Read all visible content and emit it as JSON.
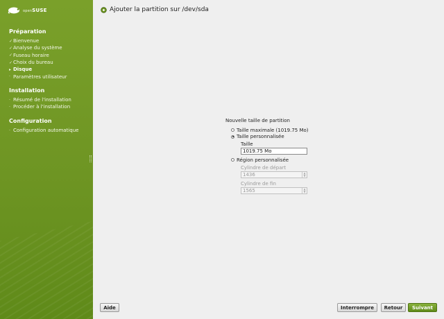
{
  "logo": {
    "brand_prefix": "open",
    "brand_name": "SUSE"
  },
  "sidebar": {
    "sections": [
      {
        "title": "Préparation",
        "items": [
          {
            "label": "Bienvenue",
            "state": "done"
          },
          {
            "label": "Analyse du système",
            "state": "done"
          },
          {
            "label": "Fuseau horaire",
            "state": "done"
          },
          {
            "label": "Choix du bureau",
            "state": "done"
          },
          {
            "label": "Disque",
            "state": "current"
          },
          {
            "label": "Paramètres utilisateur",
            "state": "pending"
          }
        ]
      },
      {
        "title": "Installation",
        "items": [
          {
            "label": "Résumé de l'installation",
            "state": "pending"
          },
          {
            "label": "Procéder à l'installation",
            "state": "pending"
          }
        ]
      },
      {
        "title": "Configuration",
        "items": [
          {
            "label": "Configuration automatique",
            "state": "pending"
          }
        ]
      }
    ],
    "marks": {
      "done": "✓",
      "current": "▸",
      "pending": "·"
    }
  },
  "main": {
    "title": "Ajouter la partition sur /dev/sda",
    "group_label": "Nouvelle taille de partition",
    "options": {
      "max_size": {
        "label": "Taille maximale (1019.75 Mo)",
        "selected": false
      },
      "custom_size": {
        "label": "Taille personnalisée",
        "selected": true,
        "field_label": "Taille",
        "field_value": "1019.75 Mo"
      },
      "custom_region": {
        "label": "Région personnalisée",
        "selected": false,
        "start_label": "Cylindre de départ",
        "start_value": "1436",
        "end_label": "Cylindre de fin",
        "end_value": "1565"
      }
    }
  },
  "buttons": {
    "help": "Aide",
    "abort": "Interrompre",
    "back": "Retour",
    "next": "Suivant"
  },
  "colors": {
    "sidebar_green": "#6e9523",
    "primary_button": "#5f8a19"
  }
}
